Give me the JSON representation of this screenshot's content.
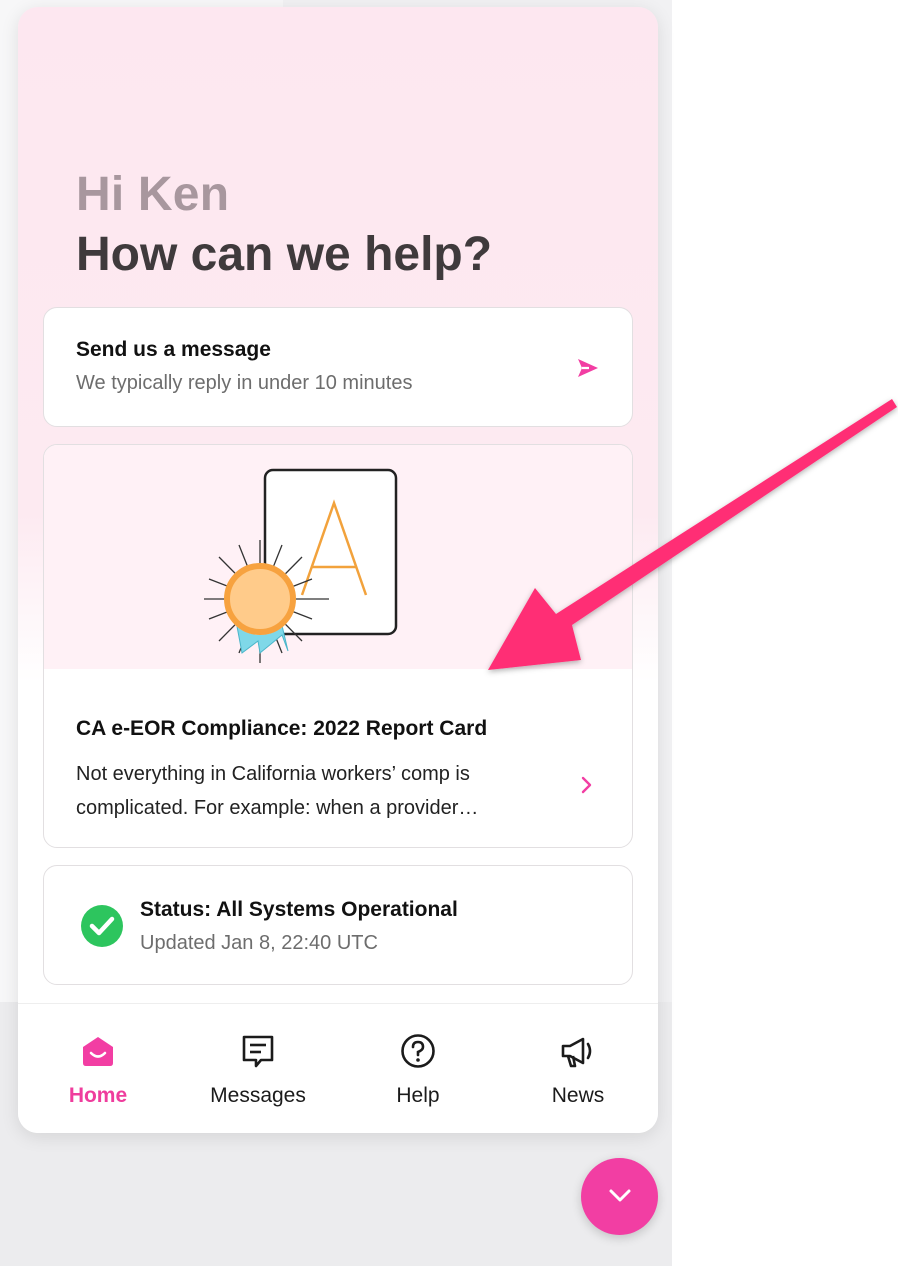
{
  "greeting": {
    "hi": "Hi Ken",
    "headline": "How can we help?"
  },
  "message_card": {
    "title": "Send us a message",
    "subtitle": "We typically reply in under 10 minutes",
    "icon": "send-icon"
  },
  "article_card": {
    "title": "CA e-EOR Compliance: 2022 Report Card",
    "body": "Not everything in California workers’ comp is complicated. For example: when a provider…",
    "icon": "chevron-right-icon"
  },
  "status_card": {
    "title": "Status: All Systems Operational",
    "subtitle": "Updated Jan 8, 22:40 UTC",
    "icon": "check-circle-icon"
  },
  "tabs": [
    {
      "label": "Home",
      "icon": "home-icon",
      "active": true
    },
    {
      "label": "Messages",
      "icon": "messages-icon",
      "active": false
    },
    {
      "label": "Help",
      "icon": "help-icon",
      "active": false
    },
    {
      "label": "News",
      "icon": "megaphone-icon",
      "active": false
    }
  ],
  "colors": {
    "accent": "#f23ea3",
    "status_green": "#2dc55e",
    "annotation_arrow": "#ff2d75"
  }
}
